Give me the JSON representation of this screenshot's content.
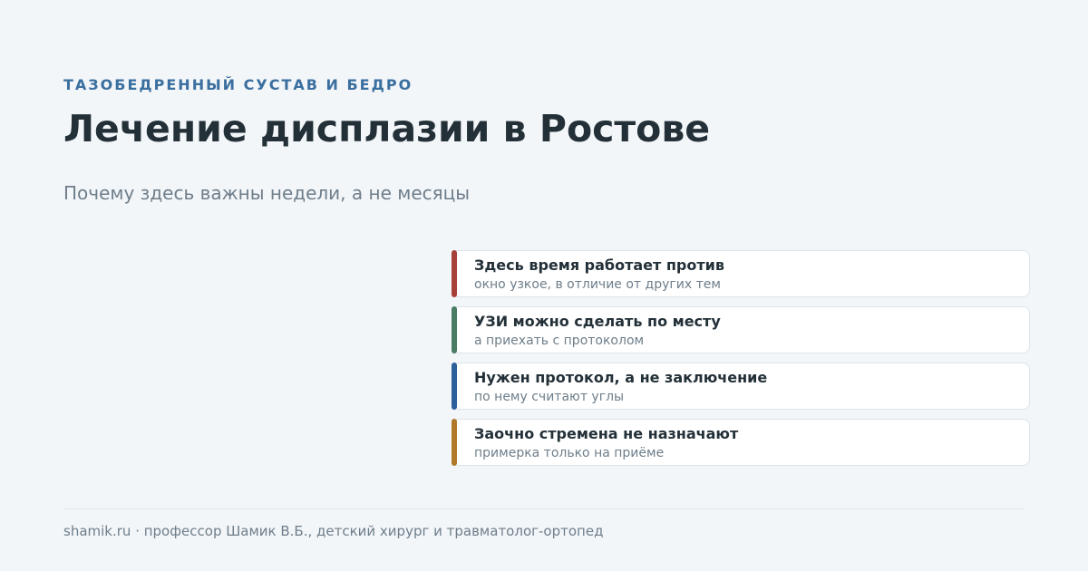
{
  "kicker": "ТАЗОБЕДРЕННЫЙ СУСТАВ И БЕДРО",
  "title": "Лечение дисплазии в Ростове",
  "subtitle": "Почему здесь важны недели, а не месяцы",
  "cards": [
    {
      "heading": "Здесь время работает против",
      "text": "окно узкое, в отличие от других тем",
      "accent": "#a8403a"
    },
    {
      "heading": "УЗИ можно сделать по месту",
      "text": "а приехать с протоколом",
      "accent": "#4a7c64"
    },
    {
      "heading": "Нужен протокол, а не заключение",
      "text": "по нему считают углы",
      "accent": "#2d609a"
    },
    {
      "heading": "Заочно стремена не назначают",
      "text": "примерка только на приёме",
      "accent": "#b07a2a"
    }
  ],
  "footer": "shamik.ru · профессор Шамик В.Б., детский хирург и травматолог-ортопед"
}
